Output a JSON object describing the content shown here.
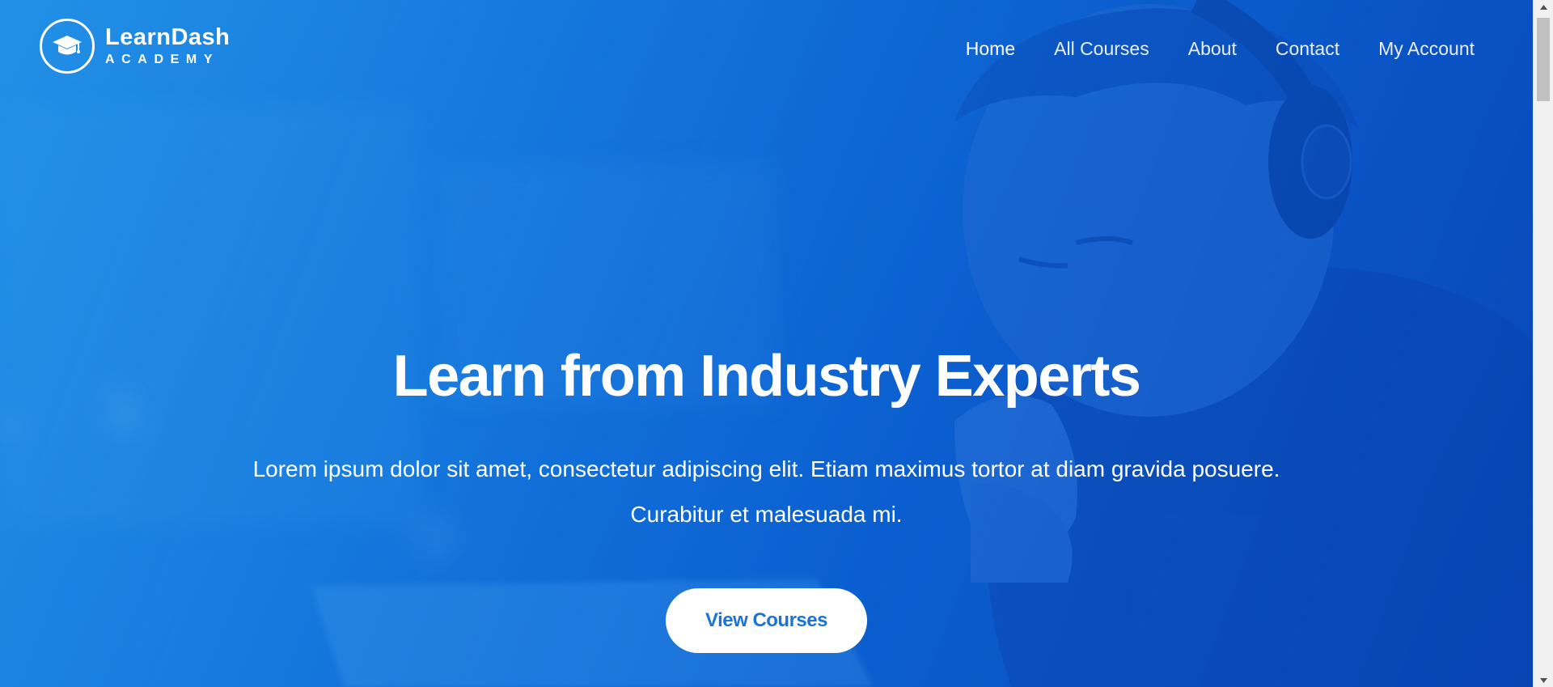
{
  "brand": {
    "name": "LearnDash",
    "tagline": "ACADEMY"
  },
  "nav": {
    "items": [
      {
        "label": "Home",
        "active": true
      },
      {
        "label": "All Courses",
        "active": false
      },
      {
        "label": "About",
        "active": false
      },
      {
        "label": "Contact",
        "active": false
      },
      {
        "label": "My Account",
        "active": false
      }
    ]
  },
  "hero": {
    "title": "Learn from Industry Experts",
    "description_line1": "Lorem ipsum dolor sit amet, consectetur adipiscing elit. Etiam maximus tortor at diam gravida posuere.",
    "description_line2": "Curabitur et malesuada mi.",
    "cta_label": "View Courses"
  },
  "icons": {
    "logo": "graduation-cap-icon",
    "scroll_up": "arrow-up-icon",
    "scroll_down": "arrow-down-icon"
  },
  "colors": {
    "hero_blue_light": "#2390e6",
    "hero_blue_dark": "#0847b7",
    "cta_text": "#1a73d9",
    "white": "#ffffff"
  }
}
